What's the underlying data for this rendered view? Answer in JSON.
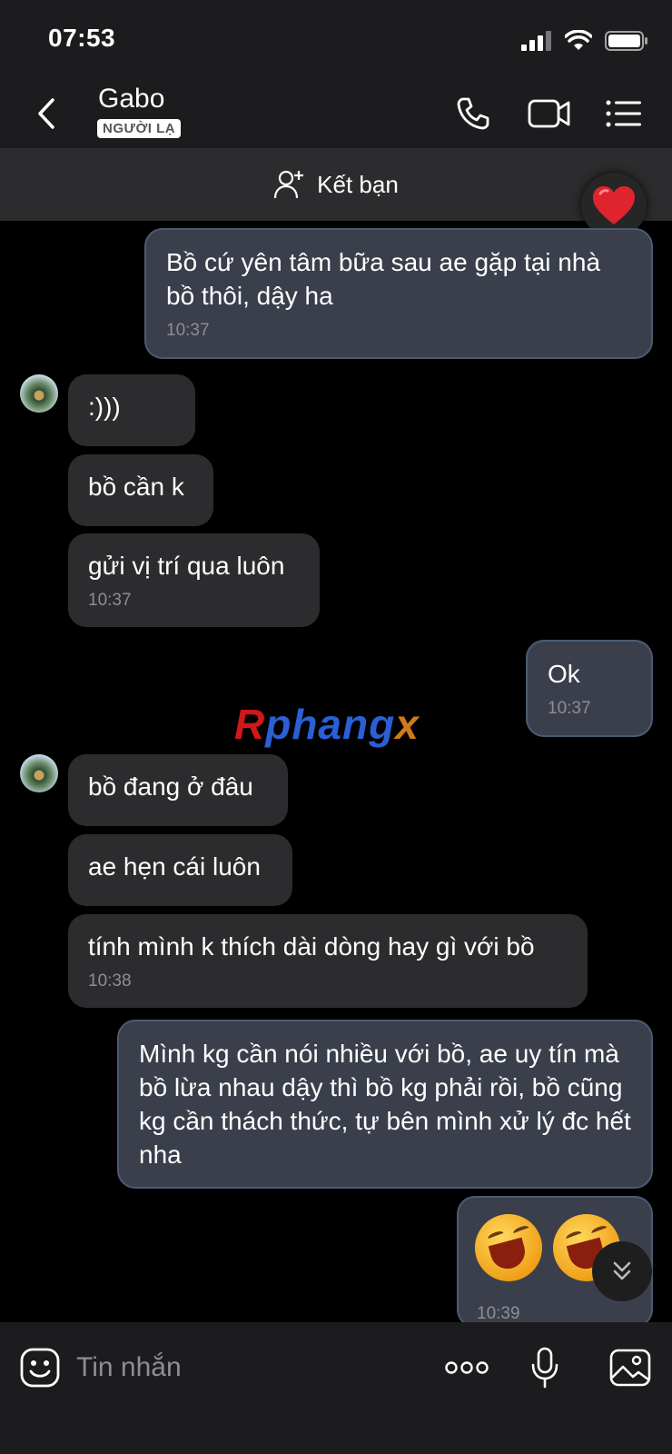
{
  "status": {
    "time": "07:53"
  },
  "header": {
    "contact_name": "Gabo",
    "badge": "NGƯỜI LẠ"
  },
  "friend_bar": {
    "label": "Kết bạn"
  },
  "messages": [
    {
      "dir": "out",
      "text": "Bồ cứ yên tâm bữa sau ae gặp tại nhà bồ thôi, dậy ha",
      "time": "10:37"
    },
    {
      "dir": "in",
      "text": ":)))"
    },
    {
      "dir": "in",
      "text": "bồ cần k"
    },
    {
      "dir": "in",
      "text": "gửi vị trí qua luôn",
      "time": "10:37"
    },
    {
      "dir": "out",
      "text": "Ok",
      "time": "10:37"
    },
    {
      "dir": "in",
      "text": "bồ đang ở đâu"
    },
    {
      "dir": "in",
      "text": "ae hẹn cái luôn"
    },
    {
      "dir": "in",
      "text": "tính mình k thích dài dòng hay gì với bồ",
      "time": "10:38"
    },
    {
      "dir": "out",
      "text": "Mình kg cần nói nhiều với bồ, ae uy tín mà bồ lừa nhau dậy thì bồ kg phải rồi, bồ cũng kg cần thách thức, tự bên mình xử lý đc hết nha"
    },
    {
      "dir": "out",
      "text": "",
      "time": "10:39"
    }
  ],
  "watermark": {
    "part1": "R",
    "part2": "phang",
    "part3": "x"
  },
  "composer": {
    "placeholder": "Tin nhắn"
  },
  "colors": {
    "incoming": "#2c2c2e",
    "outgoing": "#3a3f4b",
    "outgoing_border": "#4c5b72",
    "heart": "#e0242e"
  }
}
